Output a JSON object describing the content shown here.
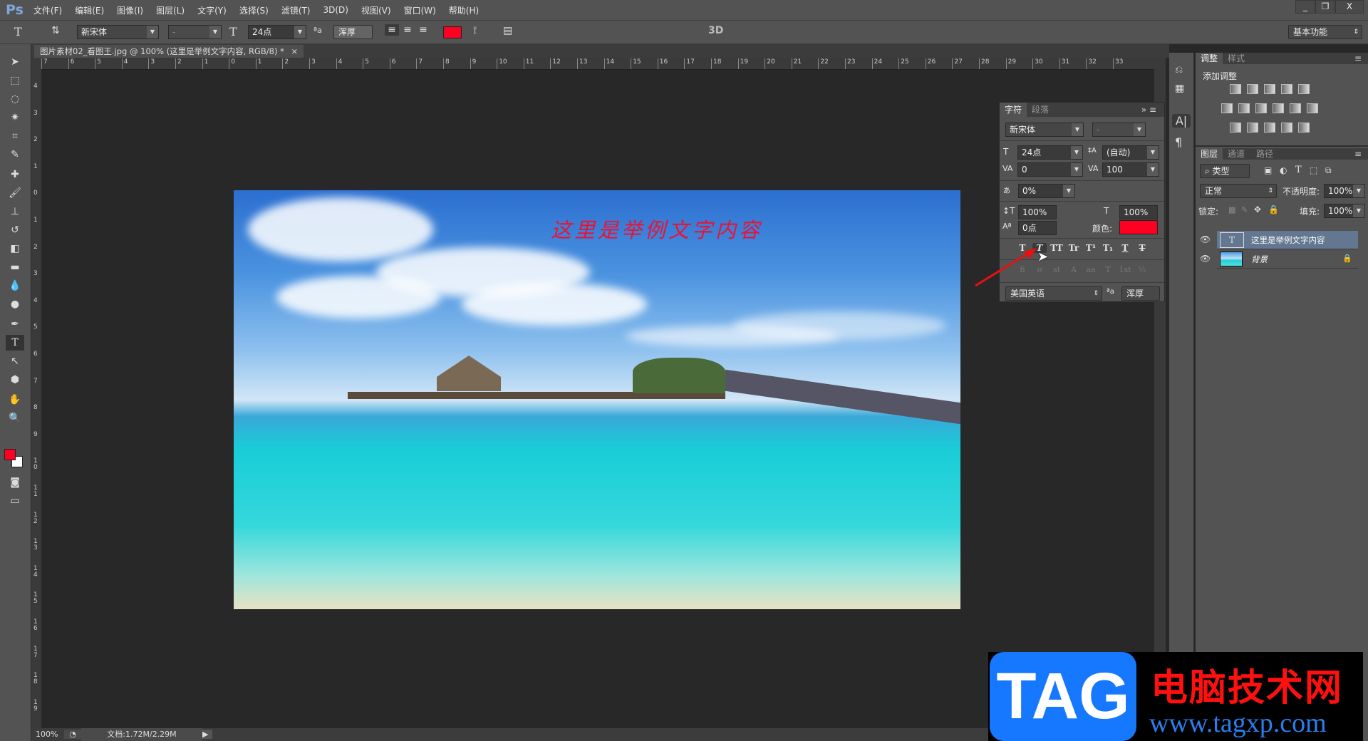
{
  "app": {
    "logo": "Ps",
    "menu": [
      "文件(F)",
      "编辑(E)",
      "图像(I)",
      "图层(L)",
      "文字(Y)",
      "选择(S)",
      "滤镜(T)",
      "3D(D)",
      "视图(V)",
      "窗口(W)",
      "帮助(H)"
    ],
    "window_buttons": [
      "_",
      "❐",
      "X"
    ]
  },
  "options": {
    "tool_icon": "T",
    "font_family": "新宋体",
    "font_style": "-",
    "font_size": "24点",
    "antialias": "浑厚",
    "color": "#ff0022",
    "mode_3d": "3D",
    "workspace": "基本功能"
  },
  "document": {
    "tab_title": "图片素材02_看图王.jpg @ 100% (这里是举例文字内容, RGB/8) *",
    "close": "×",
    "canvas_text": "这里是举例文字内容"
  },
  "rulers": {
    "horizontal": [
      "7",
      "6",
      "5",
      "4",
      "3",
      "2",
      "1",
      "0",
      "1",
      "2",
      "3",
      "4",
      "5",
      "6",
      "7",
      "8",
      "9",
      "10",
      "11",
      "12",
      "13",
      "14",
      "15",
      "16",
      "17",
      "18",
      "19",
      "20",
      "21",
      "22",
      "23",
      "24",
      "25",
      "26",
      "27",
      "28",
      "29",
      "30",
      "31",
      "32",
      "33"
    ],
    "vertical": [
      "4",
      "3",
      "2",
      "1",
      "0",
      "1",
      "2",
      "3",
      "4",
      "5",
      "6",
      "7",
      "8",
      "9",
      "10",
      "11",
      "12",
      "13",
      "14",
      "15",
      "16",
      "17",
      "18",
      "19"
    ]
  },
  "status": {
    "zoom": "100%",
    "doc": "文档:1.72M/2.29M"
  },
  "character_panel": {
    "tabs": [
      "字符",
      "段落"
    ],
    "font_family": "新宋体",
    "font_style": "-",
    "size": "24点",
    "leading": "(自动)",
    "kerning": "0",
    "tracking": "100",
    "tsume": "0%",
    "vscale": "100%",
    "hscale": "100%",
    "baseline": "0点",
    "color_label": "颜色:",
    "color": "#ff0022",
    "style_buttons": [
      "T",
      "T",
      "TT",
      "Tr",
      "T¹",
      "T₁",
      "T",
      "T"
    ],
    "opentype_buttons": [
      "fi",
      "ơ",
      "st",
      "A",
      "aa",
      "T",
      "1st",
      "½"
    ],
    "language": "美国英语",
    "aa_icon": "ªa",
    "antialias": "浑厚"
  },
  "adjustments": {
    "tabs": [
      "调整",
      "样式"
    ],
    "title": "添加调整"
  },
  "layers_panel": {
    "tabs": [
      "图层",
      "通道",
      "路径"
    ],
    "filter": "类型",
    "blend_mode": "正常",
    "opacity_label": "不透明度:",
    "opacity": "100%",
    "lock_label": "锁定:",
    "fill_label": "填充:",
    "fill": "100%",
    "layers": [
      {
        "name": "这里是举例文字内容",
        "type": "text",
        "selected": true
      },
      {
        "name": "背景",
        "type": "image",
        "locked": true
      }
    ]
  },
  "watermark": {
    "logo": "TAG",
    "name": "电脑技术网",
    "url": "www.tagxp.com"
  }
}
